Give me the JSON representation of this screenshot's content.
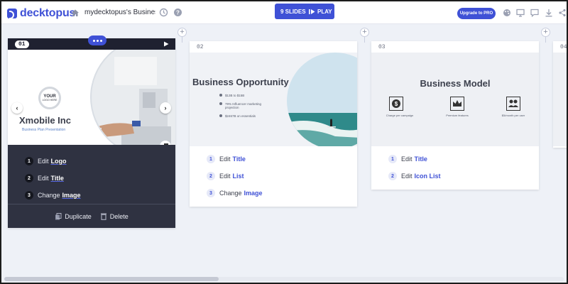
{
  "app": {
    "logo_text": "decktopus",
    "document_title": "mydecktopus's Business P",
    "brand_color": "#3f51d6"
  },
  "toolbar": {
    "slides_count": "9 SLIDES",
    "play_label": "PLAY",
    "upgrade_label": "Upgrade to PRO",
    "icons": [
      "home-icon",
      "history-icon",
      "help-icon",
      "theme-icon",
      "present-icon",
      "comment-icon",
      "download-icon",
      "share-icon"
    ]
  },
  "slides": [
    {
      "number": "01",
      "company": "Xmobile Inc",
      "subtitle": "Business Plan Presentation",
      "logo_line1": "YOUR",
      "logo_line2": "LOGO HERE",
      "edits": [
        {
          "n": "1",
          "verb": "Edit",
          "target": "Logo"
        },
        {
          "n": "2",
          "verb": "Edit",
          "target": "Title"
        },
        {
          "n": "3",
          "verb": "Change",
          "target": "Image"
        }
      ],
      "duplicate_label": "Duplicate",
      "delete_label": "Delete"
    },
    {
      "number": "02",
      "title": "Business Opportunity",
      "bullets": [
        "$13B to $15B",
        "79% Influencer marketing projection",
        "$2467B on essentials"
      ],
      "edits": [
        {
          "n": "1",
          "verb": "Edit",
          "target": "Title"
        },
        {
          "n": "2",
          "verb": "Edit",
          "target": "List"
        },
        {
          "n": "3",
          "verb": "Change",
          "target": "Image"
        }
      ]
    },
    {
      "number": "03",
      "title": "Business Model",
      "features": [
        "Charge per campaign",
        "Premium features",
        "$5/month per user"
      ],
      "edits": [
        {
          "n": "1",
          "verb": "Edit",
          "target": "Title"
        },
        {
          "n": "2",
          "verb": "Edit",
          "target": "Icon List"
        }
      ]
    },
    {
      "number": "04"
    }
  ]
}
